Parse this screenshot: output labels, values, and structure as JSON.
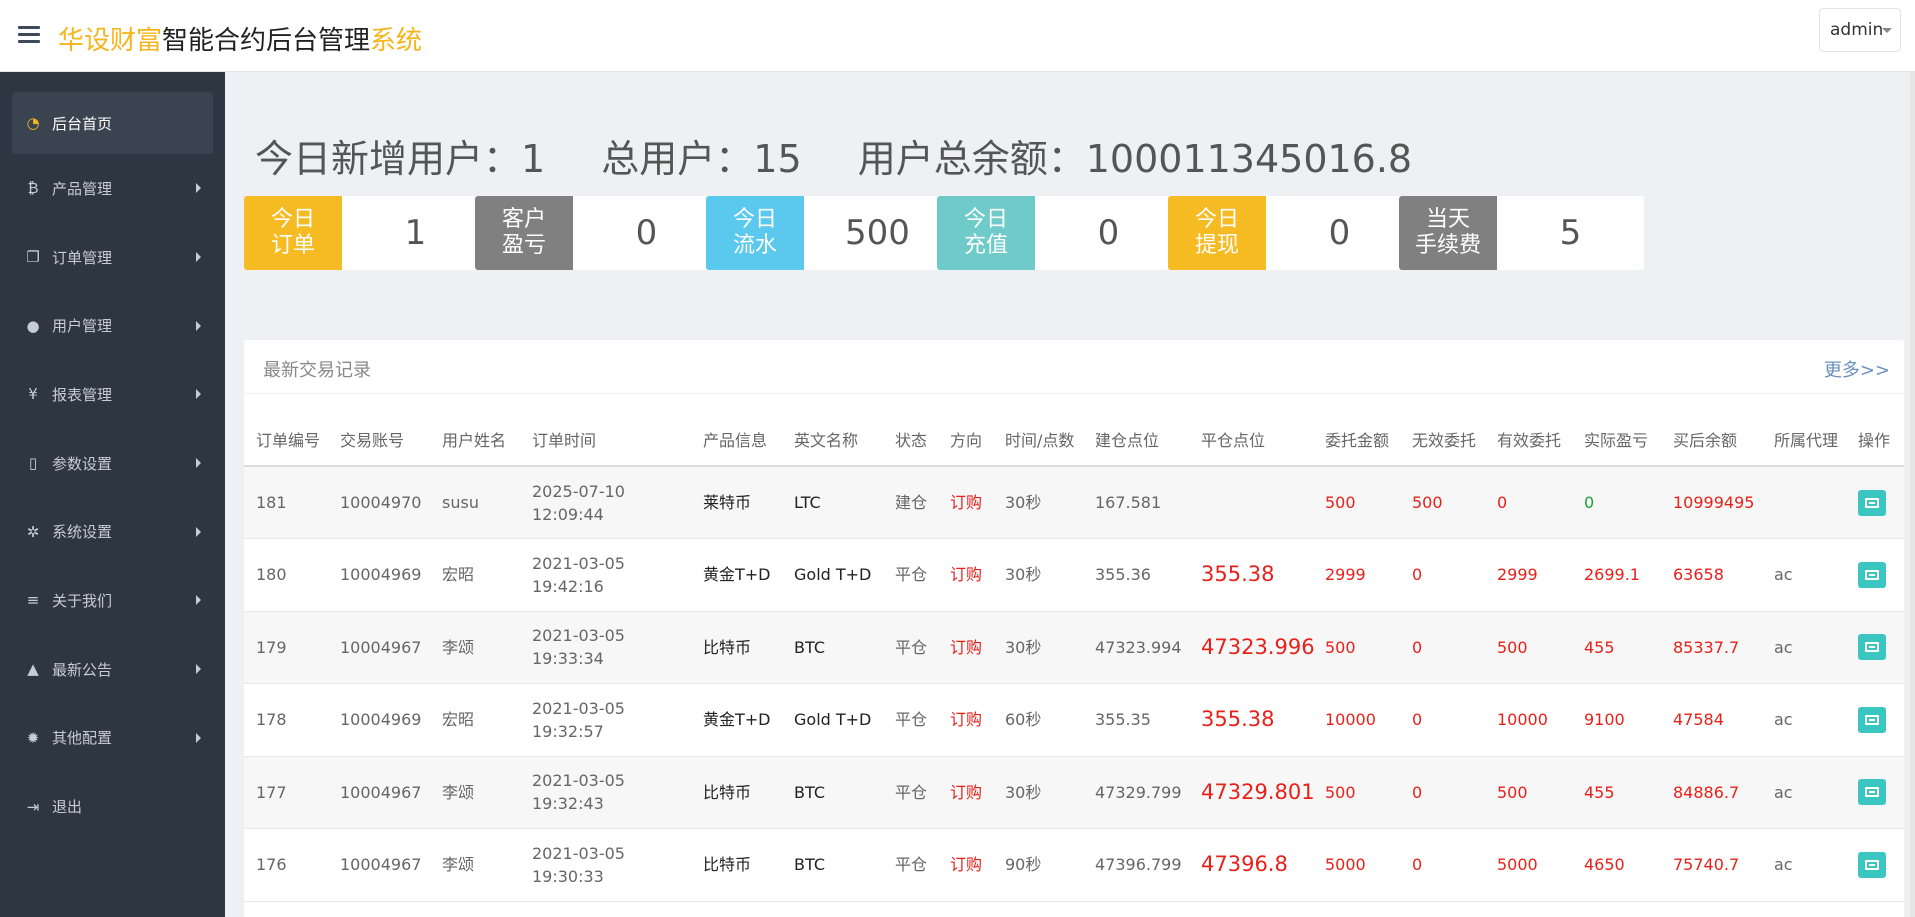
{
  "header": {
    "brand_part1": "华设财富",
    "brand_part2": "智能合约后台管理",
    "brand_part3": "系统",
    "user_label": "admin"
  },
  "sidebar": {
    "items": [
      {
        "label": "后台首页",
        "icon": "dashboard-icon",
        "active": true
      },
      {
        "label": "产品管理",
        "icon": "bitcoin-icon"
      },
      {
        "label": "订单管理",
        "icon": "copy-icon"
      },
      {
        "label": "用户管理",
        "icon": "user-icon"
      },
      {
        "label": "报表管理",
        "icon": "yen-icon"
      },
      {
        "label": "参数设置",
        "icon": "file-icon"
      },
      {
        "label": "系统设置",
        "icon": "gears-icon"
      },
      {
        "label": "关于我们",
        "icon": "bars-icon"
      },
      {
        "label": "最新公告",
        "icon": "bell-icon"
      },
      {
        "label": "其他配置",
        "icon": "gear-icon"
      },
      {
        "label": "退出",
        "icon": "signout-icon"
      }
    ]
  },
  "stats": {
    "new_users": "今日新增用户：1",
    "total_users": "总用户：15",
    "total_balance": "用户总余额：100011345016.8"
  },
  "cards": [
    {
      "label": "今日\n订单",
      "value": "1",
      "color": "#f6bb22"
    },
    {
      "label": "客户\n盈亏",
      "value": "0",
      "color": "#808080"
    },
    {
      "label": "今日\n流水",
      "value": "500",
      "color": "#5bc8ee"
    },
    {
      "label": "今日\n充值",
      "value": "0",
      "color": "#6ecbc9"
    },
    {
      "label": "今日\n提现",
      "value": "0",
      "color": "#f6bb22"
    },
    {
      "label": "当天\n手续费",
      "value": "5",
      "color": "#808080"
    }
  ],
  "panel": {
    "title": "最新交易记录",
    "more": "更多>>"
  },
  "table": {
    "headers": [
      "订单编号",
      "交易账号",
      "用户姓名",
      "订单时间",
      "产品信息",
      "英文名称",
      "状态",
      "方向",
      "时间/点数",
      "建仓点位",
      "平仓点位",
      "委托金额",
      "无效委托",
      "有效委托",
      "实际盈亏",
      "买后余额",
      "所属代理",
      "操作"
    ],
    "rows": [
      {
        "id": "181",
        "account": "10004970",
        "name": "susu",
        "time": "2025-07-10 12:09:44",
        "product": "莱特币",
        "en": "LTC",
        "status": "建仓",
        "dir": "订购",
        "dur": "30秒",
        "open": "167.581",
        "close": "",
        "amount": "500",
        "invalid": "500",
        "valid": "0",
        "pnl": "0",
        "balance": "10999495",
        "agent": ""
      },
      {
        "id": "180",
        "account": "10004969",
        "name": "宏昭",
        "time": "2021-03-05 19:42:16",
        "product": "黄金T+D",
        "en": "Gold T+D",
        "status": "平仓",
        "dir": "订购",
        "dur": "30秒",
        "open": "355.36",
        "close": "355.38",
        "amount": "2999",
        "invalid": "0",
        "valid": "2999",
        "pnl": "2699.1",
        "balance": "63658",
        "agent": "ac"
      },
      {
        "id": "179",
        "account": "10004967",
        "name": "李颂",
        "time": "2021-03-05 19:33:34",
        "product": "比特币",
        "en": "BTC",
        "status": "平仓",
        "dir": "订购",
        "dur": "30秒",
        "open": "47323.994",
        "close": "47323.996",
        "amount": "500",
        "invalid": "0",
        "valid": "500",
        "pnl": "455",
        "balance": "85337.7",
        "agent": "ac"
      },
      {
        "id": "178",
        "account": "10004969",
        "name": "宏昭",
        "time": "2021-03-05 19:32:57",
        "product": "黄金T+D",
        "en": "Gold T+D",
        "status": "平仓",
        "dir": "订购",
        "dur": "60秒",
        "open": "355.35",
        "close": "355.38",
        "amount": "10000",
        "invalid": "0",
        "valid": "10000",
        "pnl": "9100",
        "balance": "47584",
        "agent": "ac"
      },
      {
        "id": "177",
        "account": "10004967",
        "name": "李颂",
        "time": "2021-03-05 19:32:43",
        "product": "比特币",
        "en": "BTC",
        "status": "平仓",
        "dir": "订购",
        "dur": "30秒",
        "open": "47329.799",
        "close": "47329.801",
        "amount": "500",
        "invalid": "0",
        "valid": "500",
        "pnl": "455",
        "balance": "84886.7",
        "agent": "ac"
      },
      {
        "id": "176",
        "account": "10004967",
        "name": "李颂",
        "time": "2021-03-05 19:30:33",
        "product": "比特币",
        "en": "BTC",
        "status": "平仓",
        "dir": "订购",
        "dur": "90秒",
        "open": "47396.799",
        "close": "47396.8",
        "amount": "5000",
        "invalid": "0",
        "valid": "5000",
        "pnl": "4650",
        "balance": "75740.7",
        "agent": "ac"
      }
    ]
  }
}
